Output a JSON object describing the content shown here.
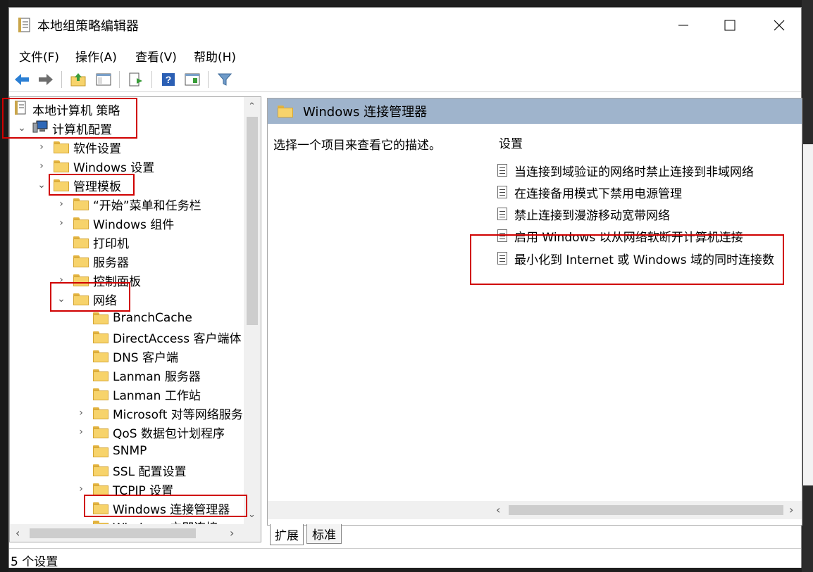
{
  "window": {
    "title": "本地组策略编辑器",
    "controls": [
      "minimize",
      "maximize",
      "close"
    ]
  },
  "menu": [
    {
      "label": "文件(F)"
    },
    {
      "label": "操作(A)"
    },
    {
      "label": "查看(V)"
    },
    {
      "label": "帮助(H)"
    }
  ],
  "toolbar": {
    "icons": [
      "back-arrow-icon",
      "forward-arrow-icon",
      "up-folder-icon",
      "show-hide-tree-icon",
      "export-list-icon",
      "help-icon",
      "properties-icon",
      "filter-icon"
    ]
  },
  "tree": {
    "items": [
      {
        "label": "本地计算机 策略"
      },
      {
        "label": "计算机配置"
      },
      {
        "label": "软件设置"
      },
      {
        "label": "Windows 设置"
      },
      {
        "label": "管理模板"
      },
      {
        "label": "“开始”菜单和任务栏"
      },
      {
        "label": "Windows 组件"
      },
      {
        "label": "打印机"
      },
      {
        "label": "服务器"
      },
      {
        "label": "控制面板"
      },
      {
        "label": "网络"
      },
      {
        "label": "BranchCache"
      },
      {
        "label": "DirectAccess 客户端体"
      },
      {
        "label": "DNS 客户端"
      },
      {
        "label": "Lanman 服务器"
      },
      {
        "label": "Lanman 工作站"
      },
      {
        "label": "Microsoft 对等网络服务"
      },
      {
        "label": "QoS 数据包计划程序"
      },
      {
        "label": "SNMP"
      },
      {
        "label": "SSL 配置设置"
      },
      {
        "label": "TCPIP 设置"
      },
      {
        "label": "Windows 连接管理器"
      },
      {
        "label": "Windows 立即连接"
      }
    ]
  },
  "detail": {
    "header": "Windows 连接管理器",
    "description": "选择一个项目来查看它的描述。",
    "settings_header": "设置",
    "settings": [
      {
        "label": "当连接到域验证的网络时禁止连接到非域网络"
      },
      {
        "label": "在连接备用模式下禁用电源管理"
      },
      {
        "label": "禁止连接到漫游移动宽带网络"
      },
      {
        "label": "启用 Windows 以从网络软断开计算机连接"
      },
      {
        "label": "最小化到 Internet 或 Windows 域的同时连接数"
      }
    ]
  },
  "tabs": [
    {
      "label": "扩展"
    },
    {
      "label": "标准"
    }
  ],
  "status": {
    "text": "5 个设置"
  },
  "colors": {
    "highlight_box": "#d00000",
    "header_bg": "#9fb4cc",
    "folder": "#f7d36b"
  }
}
